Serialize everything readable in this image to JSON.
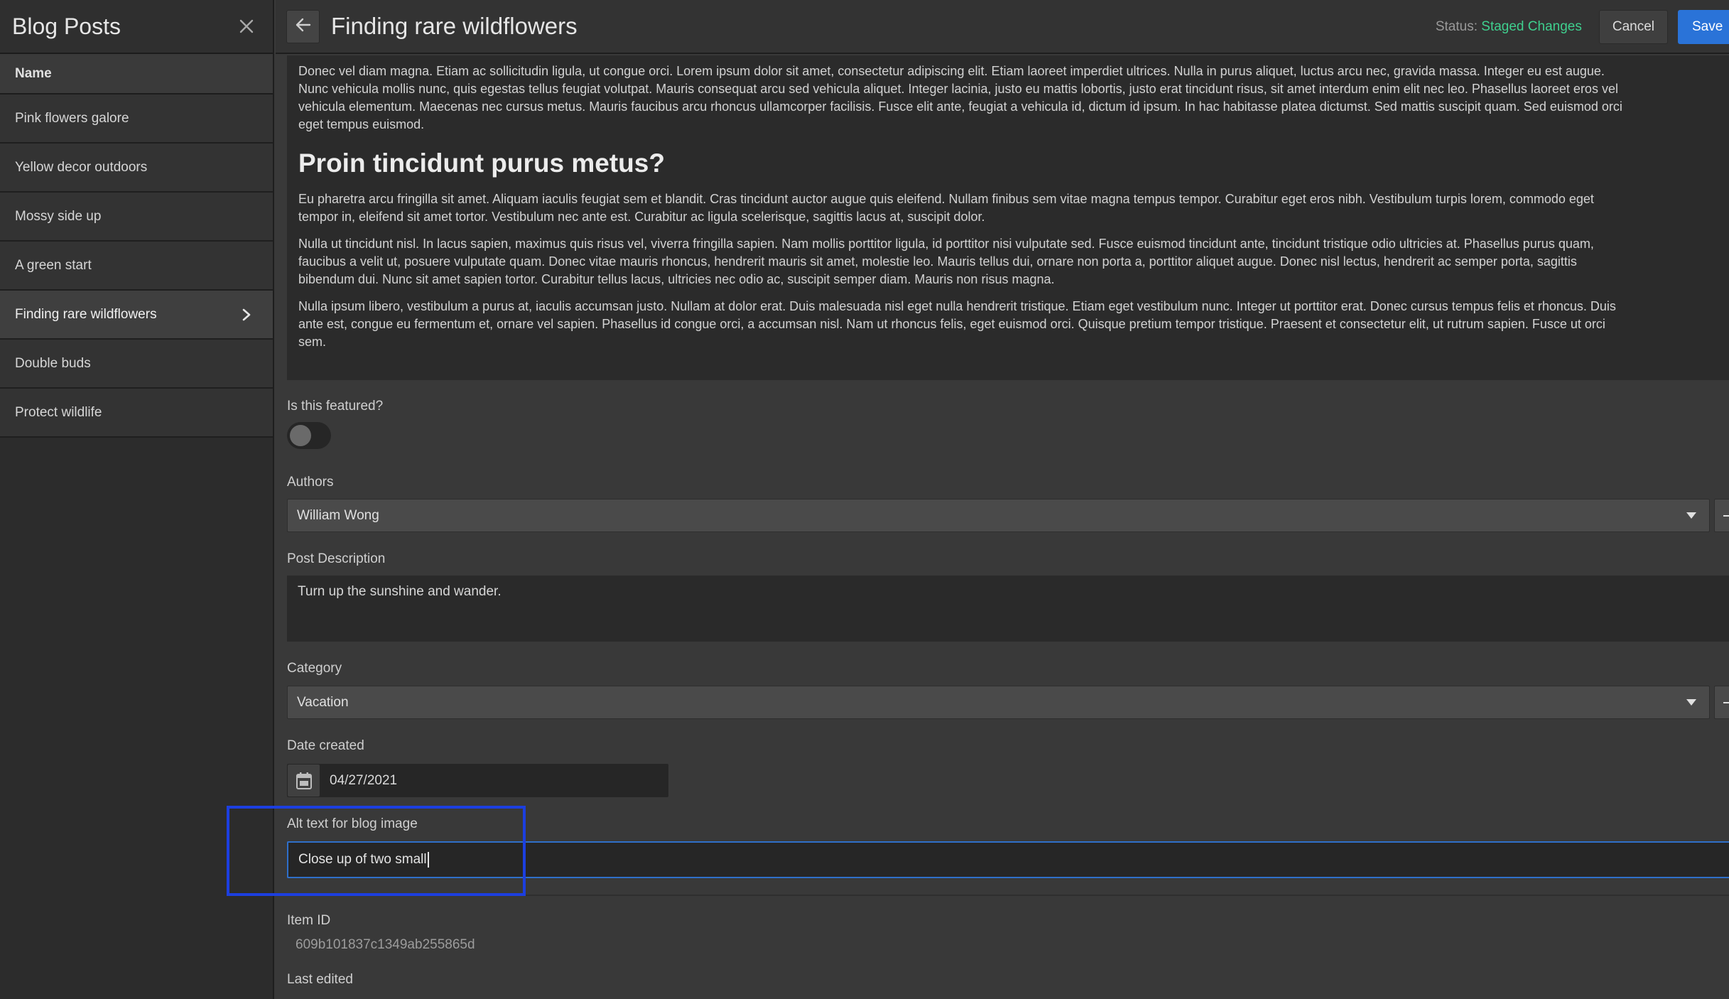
{
  "sidebar": {
    "title": "Blog Posts",
    "close_icon": "close-icon",
    "column_header": "Name",
    "items": [
      {
        "label": "Pink flowers galore"
      },
      {
        "label": "Yellow decor outdoors"
      },
      {
        "label": "Mossy side up"
      },
      {
        "label": "A green start"
      },
      {
        "label": "Finding rare wildflowers",
        "active": true
      },
      {
        "label": "Double buds"
      },
      {
        "label": "Protect wildlife"
      }
    ]
  },
  "header": {
    "title": "Finding rare wildflowers",
    "status_label": "Status:",
    "status_value": "Staged Changes",
    "cancel_label": "Cancel",
    "save_label": "Save"
  },
  "content": {
    "paragraph_1": "Donec vel diam magna. Etiam ac sollicitudin ligula, ut congue orci. Lorem ipsum dolor sit amet, consectetur adipiscing elit. Etiam laoreet imperdiet ultrices. Nulla in purus aliquet, luctus arcu nec, gravida massa. Integer eu est augue.",
    "paragraph_1b": "Nunc vehicula mollis nunc, quis egestas tellus feugiat volutpat. Mauris consequat arcu sed vehicula aliquet. Integer lacinia, justo eu mattis lobortis, justo erat tincidunt risus, sit amet interdum enim elit nec leo. Phasellus laoreet eros vel",
    "paragraph_1c": "vehicula elementum. Maecenas nec cursus metus. Mauris faucibus arcu rhoncus ullamcorper facilisis. Fusce elit ante, feugiat a vehicula id, dictum id ipsum. In hac habitasse platea dictumst. Sed mattis suscipit quam. Sed euismod orci",
    "paragraph_1d": "eget tempus euismod.",
    "heading": "Proin tincidunt purus metus?",
    "paragraph_2a": "Eu pharetra arcu fringilla sit amet. Aliquam iaculis feugiat sem et blandit. Cras tincidunt auctor augue quis eleifend. Nullam finibus sem vitae magna tempus tempor. Curabitur eget eros nibh. Vestibulum turpis lorem, commodo eget",
    "paragraph_2b": "tempor in, eleifend sit amet tortor. Vestibulum nec ante est. Curabitur ac ligula scelerisque, sagittis lacus at, suscipit dolor.",
    "paragraph_3a": "Nulla ut tincidunt nisl. In lacus sapien, maximus quis risus vel, viverra fringilla sapien. Nam mollis porttitor ligula, id porttitor nisi vulputate sed. Fusce euismod tincidunt ante, tincidunt tristique odio ultricies at. Phasellus purus quam,",
    "paragraph_3b": "faucibus a velit ut, posuere vulputate quam. Donec vitae mauris rhoncus, hendrerit mauris sit amet, molestie leo. Mauris tellus dui, ornare non porta a, porttitor aliquet augue. Donec nisl lectus, hendrerit ac semper porta, sagittis",
    "paragraph_3c": "bibendum dui. Nunc sit amet sapien tortor. Curabitur tellus lacus, ultricies nec odio ac, suscipit semper diam. Mauris non risus magna.",
    "paragraph_4a": "Nulla ipsum libero, vestibulum a purus at, iaculis accumsan justo. Nullam at dolor erat. Duis malesuada nisl eget nulla hendrerit tristique. Etiam eget vestibulum nunc. Integer ut porttitor erat. Donec cursus tempus felis et rhoncus. Duis",
    "paragraph_4b": "ante est, congue eu fermentum et, ornare vel sapien. Phasellus id congue orci, a accumsan nisl. Nam ut rhoncus felis, eget euismod orci. Quisque pretium tempor tristique. Praesent et consectetur elit, ut rutrum sapien. Fusce ut orci",
    "paragraph_4c": "sem."
  },
  "form": {
    "featured_label": "Is this featured?",
    "featured_on": false,
    "authors_label": "Authors",
    "authors_value": "William Wong",
    "description_label": "Post Description",
    "description_value": "Turn up the sunshine and wander.",
    "category_label": "Category",
    "category_value": "Vacation",
    "date_label": "Date created",
    "date_value": "04/27/2021",
    "alt_label": "Alt text for blog image",
    "alt_value": "Close up of two small",
    "item_id_label": "Item ID",
    "item_id_value": "609b101837c1349ab255865d",
    "last_edited_label": "Last edited"
  },
  "colors": {
    "accent": "#2a73d8",
    "status_green": "#3fcf8e",
    "highlight_box": "#1c3fe0"
  }
}
